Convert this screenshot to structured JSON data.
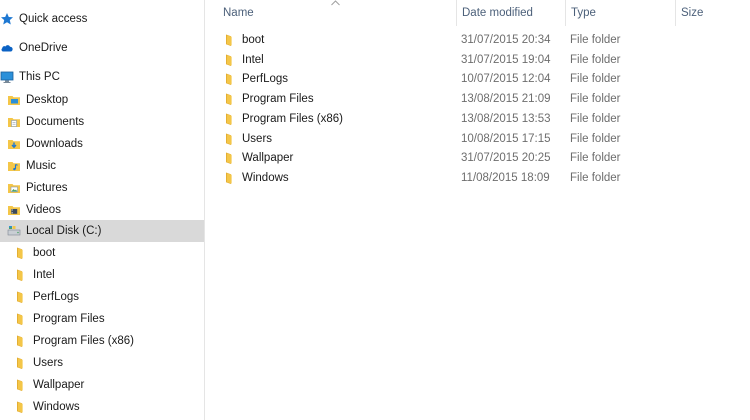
{
  "nav": {
    "items": [
      {
        "label": "Quick access",
        "icon": "star-icon",
        "level": 0
      },
      {
        "label": "OneDrive",
        "icon": "cloud-icon",
        "level": 0
      },
      {
        "label": "This PC",
        "icon": "computer-icon",
        "level": 0
      },
      {
        "label": "Desktop",
        "icon": "desktop-folder-icon",
        "level": 1
      },
      {
        "label": "Documents",
        "icon": "documents-folder-icon",
        "level": 1
      },
      {
        "label": "Downloads",
        "icon": "downloads-folder-icon",
        "level": 1
      },
      {
        "label": "Music",
        "icon": "music-folder-icon",
        "level": 1
      },
      {
        "label": "Pictures",
        "icon": "pictures-folder-icon",
        "level": 1
      },
      {
        "label": "Videos",
        "icon": "videos-folder-icon",
        "level": 1
      },
      {
        "label": "Local Disk (C:)",
        "icon": "drive-icon",
        "level": 1,
        "selected": true
      },
      {
        "label": "boot",
        "icon": "folder-icon",
        "level": 2
      },
      {
        "label": "Intel",
        "icon": "folder-icon",
        "level": 2
      },
      {
        "label": "PerfLogs",
        "icon": "folder-icon",
        "level": 2
      },
      {
        "label": "Program Files",
        "icon": "folder-icon",
        "level": 2
      },
      {
        "label": "Program Files (x86)",
        "icon": "folder-icon",
        "level": 2
      },
      {
        "label": "Users",
        "icon": "folder-icon",
        "level": 2
      },
      {
        "label": "Wallpaper",
        "icon": "folder-icon",
        "level": 2
      },
      {
        "label": "Windows",
        "icon": "folder-icon",
        "level": 2
      }
    ]
  },
  "columns": {
    "name": "Name",
    "date": "Date modified",
    "type": "Type",
    "size": "Size"
  },
  "files": [
    {
      "name": "boot",
      "date": "31/07/2015 20:34",
      "type": "File folder"
    },
    {
      "name": "Intel",
      "date": "31/07/2015 19:04",
      "type": "File folder"
    },
    {
      "name": "PerfLogs",
      "date": "10/07/2015 12:04",
      "type": "File folder"
    },
    {
      "name": "Program Files",
      "date": "13/08/2015 21:09",
      "type": "File folder"
    },
    {
      "name": "Program Files (x86)",
      "date": "13/08/2015 13:53",
      "type": "File folder"
    },
    {
      "name": "Users",
      "date": "10/08/2015 17:15",
      "type": "File folder"
    },
    {
      "name": "Wallpaper",
      "date": "31/07/2015 20:25",
      "type": "File folder"
    },
    {
      "name": "Windows",
      "date": "11/08/2015 18:09",
      "type": "File folder"
    }
  ],
  "colors": {
    "folder": "#f4c648",
    "folder_dark": "#e0a92e",
    "selected_bg": "#d9d9d9",
    "header_text": "#4c607a",
    "secondary_text": "#6d6d6d",
    "accent_blue": "#1e78d2"
  }
}
